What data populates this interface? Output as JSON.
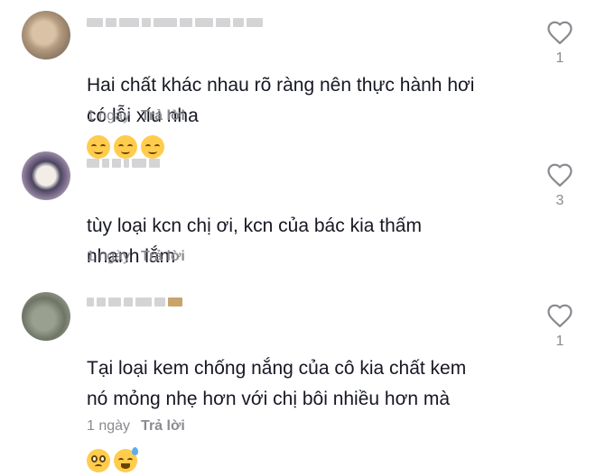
{
  "comments": [
    {
      "text": "Hai chất khác nhau rõ ràng nên thực hành hơi\ncó lỗi xíu nha",
      "emojis": [
        "relieved-face",
        "relieved-face",
        "relieved-face"
      ],
      "time": "1 ngày",
      "reply_label": "Trả lời",
      "like_count": "1",
      "icon": "heart-outline-icon"
    },
    {
      "text": "tùy loại kcn chị ơi, kcn của bác kia thấm\nnhanh lắm",
      "emojis": [],
      "time": "1 ngày",
      "reply_label": "Trả lời",
      "like_count": "3",
      "icon": "heart-outline-icon"
    },
    {
      "text": "Tại loại kem chống nắng của cô kia chất kem\nnó mỏng nhẹ hơn với chị bôi nhiều hơn mà",
      "emojis": [
        "pleading-face",
        "grinning-face-with-sweat"
      ],
      "time": "1 ngày",
      "reply_label": "Trả lời",
      "like_count": "1",
      "icon": "heart-outline-icon"
    }
  ],
  "colors": {
    "text": "#161823",
    "muted": "#8a8b91",
    "heart_stroke": "#8a8b91",
    "emoji_yellow": "#ffcc4d"
  }
}
